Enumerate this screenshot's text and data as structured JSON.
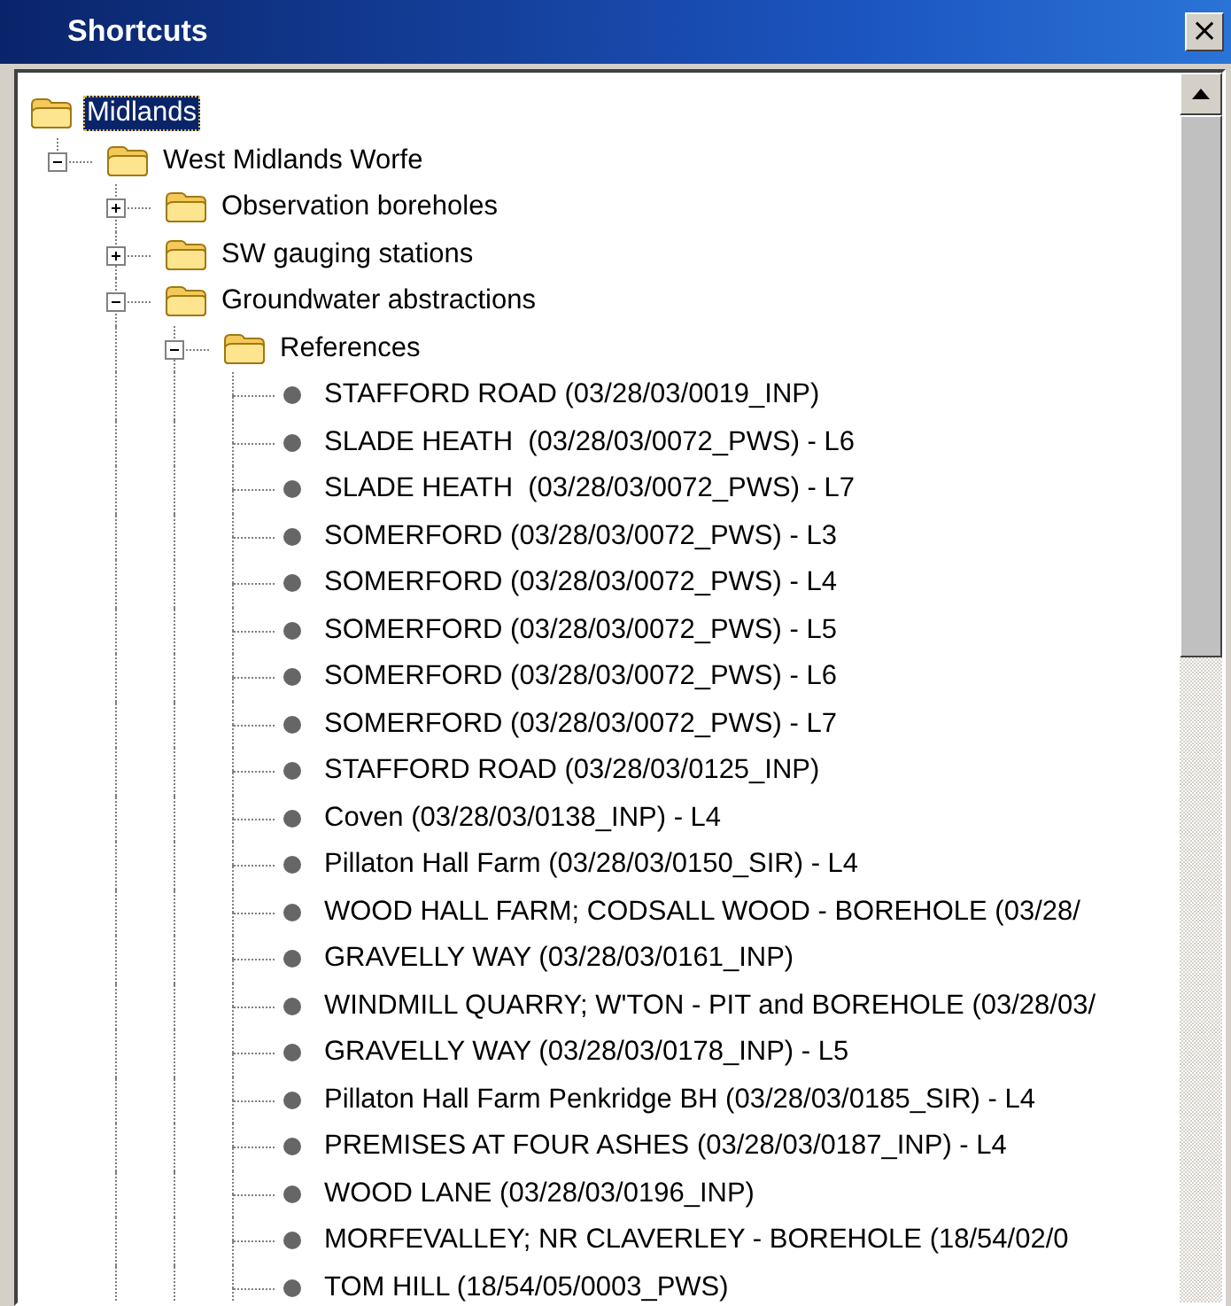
{
  "window": {
    "title": "Shortcuts",
    "close": "×"
  },
  "tree": [
    {
      "label": "Midlands",
      "kind": "folder",
      "selected": true,
      "children": [
        {
          "label": "West Midlands Worfe",
          "kind": "folder",
          "selected": false,
          "expanded": true,
          "children": [
            {
              "label": "Observation boreholes",
              "kind": "folder",
              "selected": false,
              "expanded": false
            },
            {
              "label": "SW gauging stations",
              "kind": "folder",
              "selected": false,
              "expanded": false
            },
            {
              "label": "Groundwater abstractions",
              "kind": "folder",
              "selected": false,
              "expanded": true,
              "children": [
                {
                  "label": "References",
                  "kind": "folder",
                  "selected": false,
                  "expanded": true,
                  "children": [
                    {
                      "label": "STAFFORD ROAD (03/28/03/0019_INP)",
                      "kind": "leaf",
                      "selected": false
                    },
                    {
                      "label": "SLADE HEATH  (03/28/03/0072_PWS) - L6",
                      "kind": "leaf",
                      "selected": false
                    },
                    {
                      "label": "SLADE HEATH  (03/28/03/0072_PWS) - L7",
                      "kind": "leaf",
                      "selected": false
                    },
                    {
                      "label": "SOMERFORD (03/28/03/0072_PWS) - L3",
                      "kind": "leaf",
                      "selected": false
                    },
                    {
                      "label": "SOMERFORD (03/28/03/0072_PWS) - L4",
                      "kind": "leaf",
                      "selected": false
                    },
                    {
                      "label": "SOMERFORD (03/28/03/0072_PWS) - L5",
                      "kind": "leaf",
                      "selected": false
                    },
                    {
                      "label": "SOMERFORD (03/28/03/0072_PWS) - L6",
                      "kind": "leaf",
                      "selected": false
                    },
                    {
                      "label": "SOMERFORD (03/28/03/0072_PWS) - L7",
                      "kind": "leaf",
                      "selected": false
                    },
                    {
                      "label": "STAFFORD ROAD (03/28/03/0125_INP)",
                      "kind": "leaf",
                      "selected": false
                    },
                    {
                      "label": "Coven (03/28/03/0138_INP) - L4",
                      "kind": "leaf",
                      "selected": false
                    },
                    {
                      "label": "Pillaton Hall Farm (03/28/03/0150_SIR) - L4",
                      "kind": "leaf",
                      "selected": false
                    },
                    {
                      "label": "WOOD HALL FARM; CODSALL WOOD - BOREHOLE (03/28/",
                      "kind": "leaf",
                      "selected": false
                    },
                    {
                      "label": "GRAVELLY WAY (03/28/03/0161_INP)",
                      "kind": "leaf",
                      "selected": false
                    },
                    {
                      "label": "WINDMILL QUARRY; W'TON - PIT and BOREHOLE (03/28/03/",
                      "kind": "leaf",
                      "selected": false
                    },
                    {
                      "label": "GRAVELLY WAY (03/28/03/0178_INP) - L5",
                      "kind": "leaf",
                      "selected": false
                    },
                    {
                      "label": "Pillaton Hall Farm Penkridge BH (03/28/03/0185_SIR) - L4",
                      "kind": "leaf",
                      "selected": false
                    },
                    {
                      "label": "PREMISES AT FOUR ASHES (03/28/03/0187_INP) - L4",
                      "kind": "leaf",
                      "selected": false
                    },
                    {
                      "label": "WOOD LANE (03/28/03/0196_INP)",
                      "kind": "leaf",
                      "selected": false
                    },
                    {
                      "label": "MORFEVALLEY; NR CLAVERLEY - BOREHOLE (18/54/02/0",
                      "kind": "leaf",
                      "selected": false
                    },
                    {
                      "label": "TOM HILL (18/54/05/0003_PWS)",
                      "kind": "leaf",
                      "selected": false
                    }
                  ]
                }
              ]
            }
          ]
        }
      ]
    }
  ]
}
